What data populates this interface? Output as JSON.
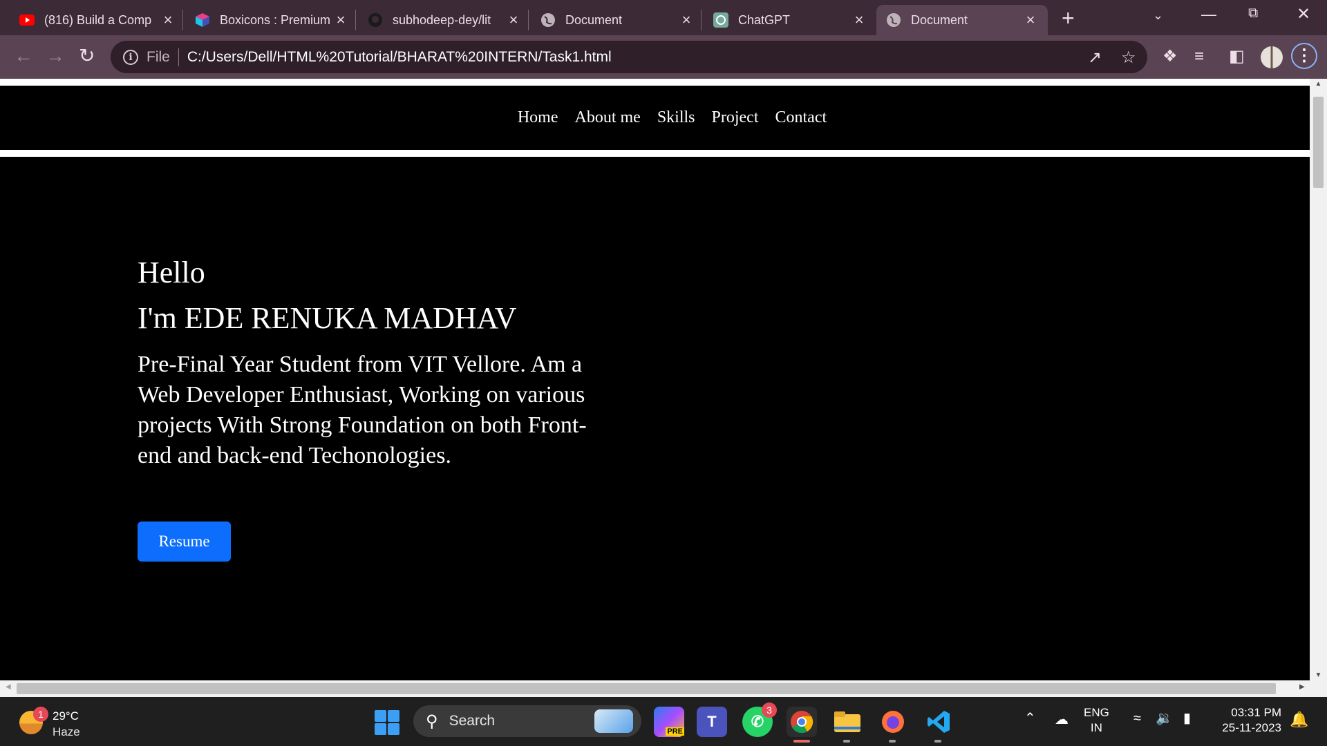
{
  "browser": {
    "tabs": [
      {
        "title": "(816) Build a Comp",
        "icon": "youtube-icon"
      },
      {
        "title": "Boxicons : Premium",
        "icon": "boxicons-icon"
      },
      {
        "title": "subhodeep-dey/lit",
        "icon": "github-icon"
      },
      {
        "title": "Document",
        "icon": "globe-icon"
      },
      {
        "title": "ChatGPT",
        "icon": "chatgpt-icon"
      },
      {
        "title": "Document",
        "icon": "globe-icon",
        "active": true
      }
    ],
    "new_tab": "+",
    "address": {
      "scheme_label": "File",
      "url": "C:/Users/Dell/HTML%20Tutorial/BHARAT%20INTERN/Task1.html"
    }
  },
  "site": {
    "nav": [
      "Home",
      "About me",
      "Skills",
      "Project",
      "Contact"
    ],
    "hero": {
      "greeting": "Hello",
      "name": "I'm EDE RENUKA MADHAV",
      "description": "Pre-Final Year Student from VIT Vellore. Am a Web Developer Enthusiast, Working on various projects With Strong Foundation on both Front-end and back-end Techonologies."
    },
    "resume_button": "Resume",
    "colors": {
      "background": "#000000",
      "text": "#ffffff",
      "button": "#0d6efd"
    }
  },
  "taskbar": {
    "weather": {
      "temp": "29°C",
      "condition": "Haze",
      "badge": "1"
    },
    "search_label": "Search",
    "whatsapp_badge": "3",
    "language": {
      "line1": "ENG",
      "line2": "IN"
    },
    "clock": {
      "time": "03:31 PM",
      "date": "25-11-2023"
    }
  }
}
